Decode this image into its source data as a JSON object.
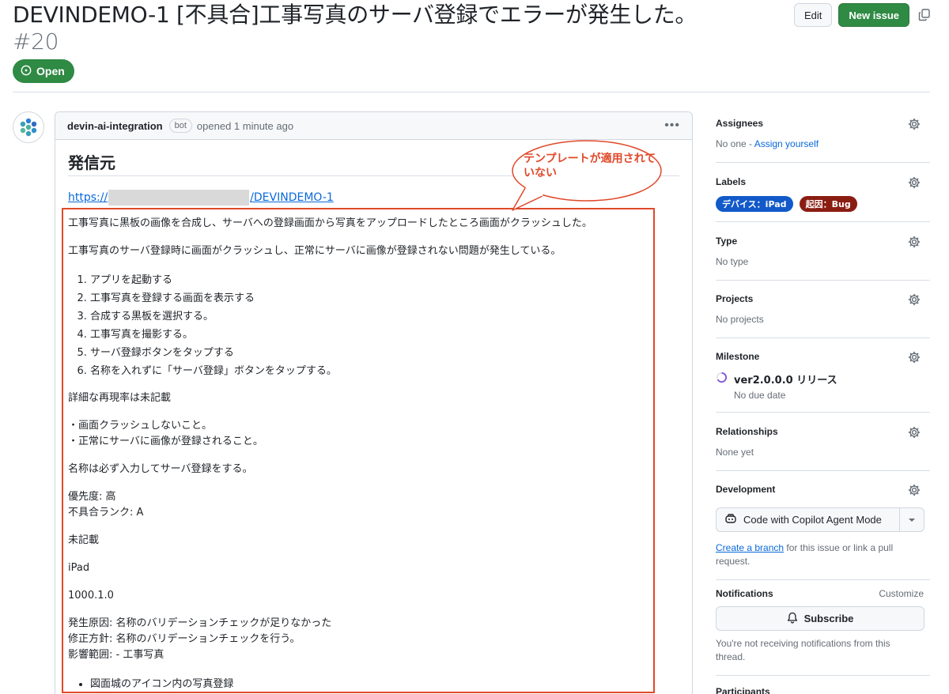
{
  "issue": {
    "title": "DEVINDEMO-1 [不具合]工事写真のサーバ登録でエラーが発生した。",
    "number": "#20",
    "state": "Open",
    "edit_label": "Edit",
    "new_issue_label": "New issue"
  },
  "comment": {
    "author": "devin-ai-integration",
    "badge": "bot",
    "timestamp": "opened 1 minute ago",
    "heading": "発信元",
    "link_prefix": "https://",
    "link_suffix": "/DEVINDEMO-1",
    "p1": "工事写真に黒板の画像を合成し、サーバへの登録画面から写真をアップロードしたところ画面がクラッシュした。",
    "p2": "工事写真のサーバ登録時に画面がクラッシュし、正常にサーバに画像が登録されない問題が発生している。",
    "steps": [
      "アプリを起動する",
      "工事写真を登録する画面を表示する",
      "合成する黒板を選択する。",
      "工事写真を撮影する。",
      "サーバ登録ボタンをタップする",
      "名称を入れずに「サーバ登録」ボタンをタップする。"
    ],
    "p3": "詳細な再現率は未記載",
    "p4a": "・画面クラッシュしないこと。",
    "p4b": "・正常にサーバに画像が登録されること。",
    "p5": "名称は必ず入力してサーバ登録をする。",
    "p6a": "優先度: 高",
    "p6b": "不具合ランク: A",
    "p7": "未記載",
    "p8": "iPad",
    "p9": "1000.1.0",
    "p10a": "発生原因: 名称のバリデーションチェックが足りなかった",
    "p10b": "修正方針: 名称のバリデーションチェックを行う。",
    "p10c": "影響範囲: - 工事写真",
    "bullets": [
      "図面城のアイコン内の写真登録"
    ]
  },
  "callout": {
    "text": "テンプレートが適用されていない",
    "color": "#e0492a"
  },
  "sidebar": {
    "assignees": {
      "title": "Assignees",
      "value": "No one - ",
      "link": "Assign yourself"
    },
    "labels": {
      "title": "Labels",
      "items": [
        {
          "name": "デバイス：iPad",
          "color": "#1259c9"
        },
        {
          "name": "起因：Bug",
          "color": "#8a1d12"
        }
      ]
    },
    "type": {
      "title": "Type",
      "value": "No type"
    },
    "projects": {
      "title": "Projects",
      "value": "No projects"
    },
    "milestone": {
      "title": "Milestone",
      "name": "ver2.0.0.0 リリース",
      "due": "No due date"
    },
    "relationships": {
      "title": "Relationships",
      "value": "None yet"
    },
    "development": {
      "title": "Development",
      "button": "Code with Copilot Agent Mode",
      "link": "Create a branch",
      "rest": "for this issue or link a pull request."
    },
    "notifications": {
      "title": "Notifications",
      "customize": "Customize",
      "button": "Subscribe",
      "note": "You're not receiving notifications from this thread."
    },
    "participants": {
      "title": "Participants"
    }
  }
}
